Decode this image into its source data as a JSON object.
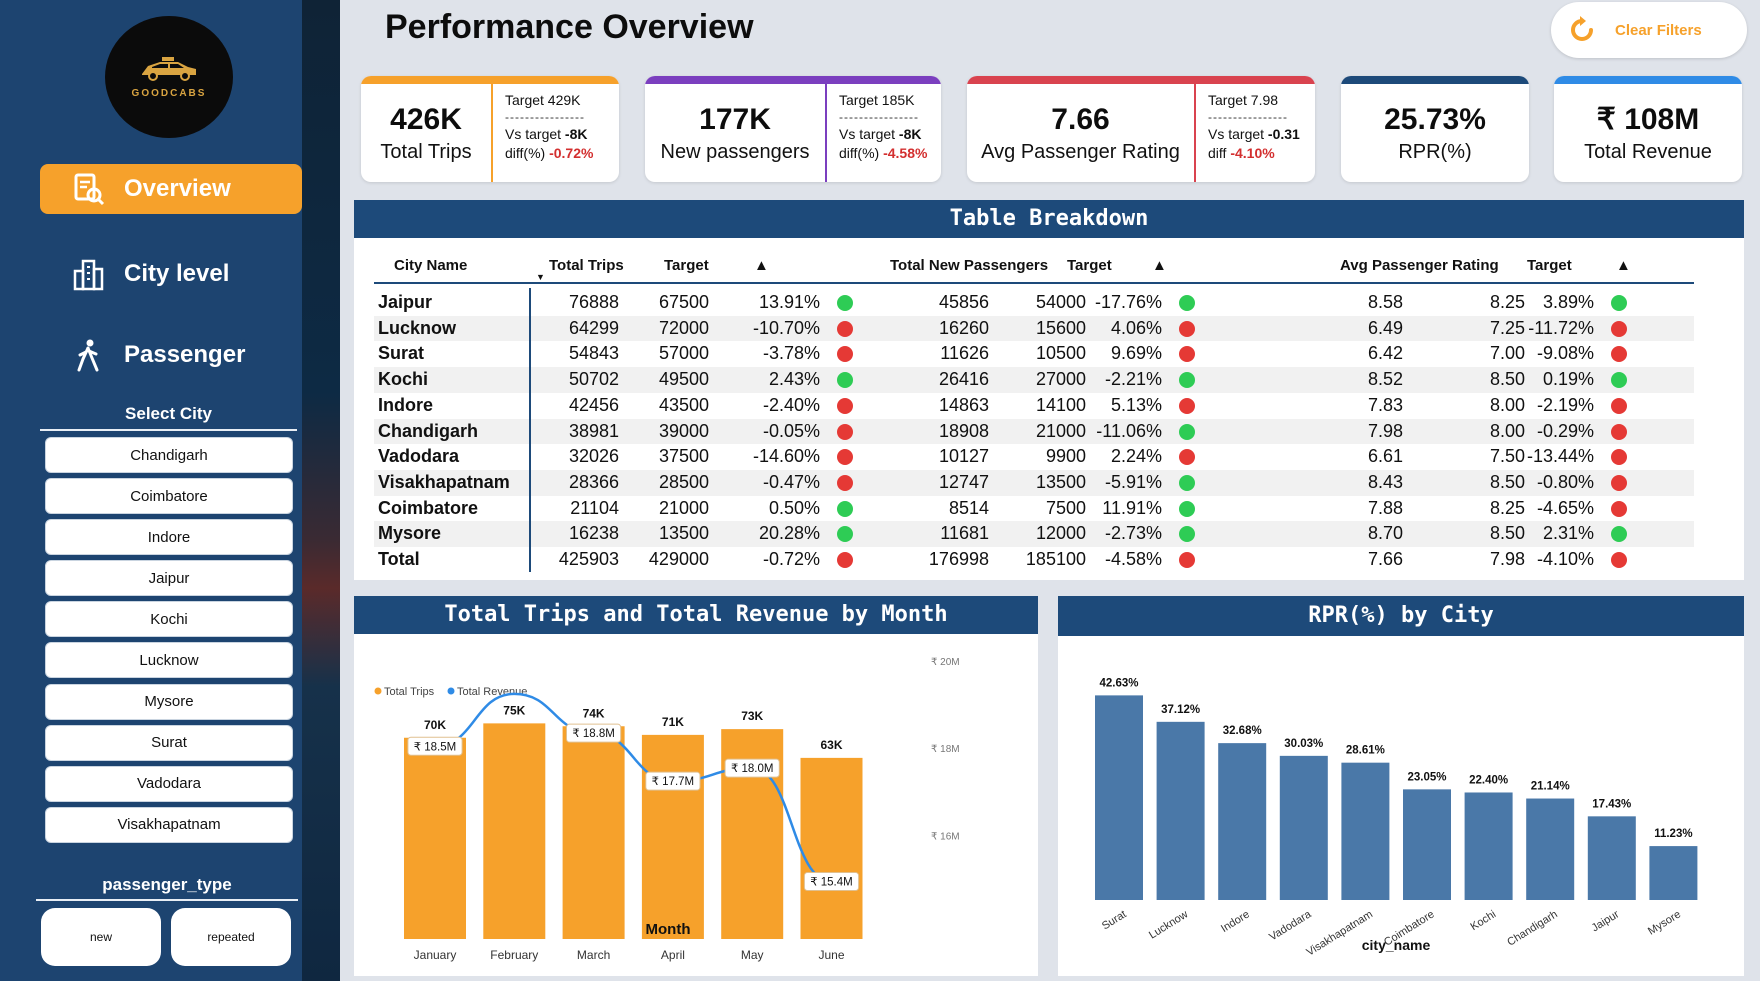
{
  "app": {
    "logo_text": "GOODCABS",
    "page_title": "Performance Overview",
    "clear_filters": "Clear Filters"
  },
  "nav": [
    {
      "label": "Overview",
      "icon": "report-search-icon",
      "active": true
    },
    {
      "label": "City level",
      "icon": "city-buildings-icon",
      "active": false
    },
    {
      "label": "Passenger",
      "icon": "walking-person-icon",
      "active": false
    }
  ],
  "select_city": {
    "title": "Select City",
    "cities": [
      "Chandigarh",
      "Coimbatore",
      "Indore",
      "Jaipur",
      "Kochi",
      "Lucknow",
      "Mysore",
      "Surat",
      "Vadodara",
      "Visakhapatnam"
    ]
  },
  "passenger_type": {
    "title": "passenger_type",
    "options": [
      "new",
      "repeated"
    ]
  },
  "kpis": [
    {
      "value": "426K",
      "label": "Total Trips",
      "target": "Target 429K",
      "dash": "----------------",
      "vs_label": "Vs target",
      "vs": "-8K",
      "diff_label": "diff(%)",
      "diff": "-0.72%",
      "color": "#f6a12b"
    },
    {
      "value": "177K",
      "label": "New passengers",
      "target": "Target 185K",
      "dash": "----------------",
      "vs_label": "Vs target",
      "vs": "-8K",
      "diff_label": "diff(%)",
      "diff": "-4.58%",
      "color": "#7b3fbf"
    },
    {
      "value": "7.66",
      "label": "Avg Passenger Rating",
      "target": "Target 7.98",
      "dash": "----------------",
      "vs_label": "Vs target",
      "vs": "-0.31",
      "diff_label": "diff",
      "diff": "-4.10%",
      "color": "#d9434f"
    },
    {
      "value": "25.73%",
      "label": "RPR(%)",
      "color": "#1d4a7a"
    },
    {
      "value": "₹ 108M",
      "label": "Total Revenue",
      "color": "#2f8be6"
    }
  ],
  "table": {
    "title": "Table Breakdown",
    "headers": [
      "City Name",
      "Total Trips",
      "Target",
      "▲",
      "Total New Passengers",
      "Target",
      "▲",
      "Avg Passenger Rating",
      "Target",
      "▲"
    ],
    "rows": [
      {
        "city": "Jaipur",
        "trips": "76888",
        "trips_target": "67500",
        "trips_diff": "13.91%",
        "trips_status": "green",
        "newp": "45856",
        "newp_target": "54000",
        "newp_diff": "-17.76%",
        "newp_status": "green",
        "rating": "8.58",
        "rating_target": "8.25",
        "rating_diff": "3.89%",
        "rating_status": "green"
      },
      {
        "city": "Lucknow",
        "trips": "64299",
        "trips_target": "72000",
        "trips_diff": "-10.70%",
        "trips_status": "red",
        "newp": "16260",
        "newp_target": "15600",
        "newp_diff": "4.06%",
        "newp_status": "red",
        "rating": "6.49",
        "rating_target": "7.25",
        "rating_diff": "-11.72%",
        "rating_status": "red"
      },
      {
        "city": "Surat",
        "trips": "54843",
        "trips_target": "57000",
        "trips_diff": "-3.78%",
        "trips_status": "red",
        "newp": "11626",
        "newp_target": "10500",
        "newp_diff": "9.69%",
        "newp_status": "red",
        "rating": "6.42",
        "rating_target": "7.00",
        "rating_diff": "-9.08%",
        "rating_status": "red"
      },
      {
        "city": "Kochi",
        "trips": "50702",
        "trips_target": "49500",
        "trips_diff": "2.43%",
        "trips_status": "green",
        "newp": "26416",
        "newp_target": "27000",
        "newp_diff": "-2.21%",
        "newp_status": "green",
        "rating": "8.52",
        "rating_target": "8.50",
        "rating_diff": "0.19%",
        "rating_status": "green"
      },
      {
        "city": "Indore",
        "trips": "42456",
        "trips_target": "43500",
        "trips_diff": "-2.40%",
        "trips_status": "red",
        "newp": "14863",
        "newp_target": "14100",
        "newp_diff": "5.13%",
        "newp_status": "red",
        "rating": "7.83",
        "rating_target": "8.00",
        "rating_diff": "-2.19%",
        "rating_status": "red"
      },
      {
        "city": "Chandigarh",
        "trips": "38981",
        "trips_target": "39000",
        "trips_diff": "-0.05%",
        "trips_status": "red",
        "newp": "18908",
        "newp_target": "21000",
        "newp_diff": "-11.06%",
        "newp_status": "green",
        "rating": "7.98",
        "rating_target": "8.00",
        "rating_diff": "-0.29%",
        "rating_status": "red"
      },
      {
        "city": "Vadodara",
        "trips": "32026",
        "trips_target": "37500",
        "trips_diff": "-14.60%",
        "trips_status": "red",
        "newp": "10127",
        "newp_target": "9900",
        "newp_diff": "2.24%",
        "newp_status": "red",
        "rating": "6.61",
        "rating_target": "7.50",
        "rating_diff": "-13.44%",
        "rating_status": "red"
      },
      {
        "city": "Visakhapatnam",
        "trips": "28366",
        "trips_target": "28500",
        "trips_diff": "-0.47%",
        "trips_status": "red",
        "newp": "12747",
        "newp_target": "13500",
        "newp_diff": "-5.91%",
        "newp_status": "green",
        "rating": "8.43",
        "rating_target": "8.50",
        "rating_diff": "-0.80%",
        "rating_status": "red"
      },
      {
        "city": "Coimbatore",
        "trips": "21104",
        "trips_target": "21000",
        "trips_diff": "0.50%",
        "trips_status": "green",
        "newp": "8514",
        "newp_target": "7500",
        "newp_diff": "11.91%",
        "newp_status": "green",
        "rating": "7.88",
        "rating_target": "8.25",
        "rating_diff": "-4.65%",
        "rating_status": "red"
      },
      {
        "city": "Mysore",
        "trips": "16238",
        "trips_target": "13500",
        "trips_diff": "20.28%",
        "trips_status": "green",
        "newp": "11681",
        "newp_target": "12000",
        "newp_diff": "-2.73%",
        "newp_status": "green",
        "rating": "8.70",
        "rating_target": "8.50",
        "rating_diff": "2.31%",
        "rating_status": "green"
      },
      {
        "city": "Total",
        "trips": "425903",
        "trips_target": "429000",
        "trips_diff": "-0.72%",
        "trips_status": "red",
        "newp": "176998",
        "newp_target": "185100",
        "newp_diff": "-4.58%",
        "newp_status": "red",
        "rating": "7.66",
        "rating_target": "7.98",
        "rating_diff": "-4.10%",
        "rating_status": "red"
      }
    ]
  },
  "colors": {
    "green": "#2ecc55",
    "red": "#e53935",
    "orange": "#f6a12b",
    "navy": "#1d4a7a",
    "steel": "#4a78a8",
    "line": "#2f8be6"
  },
  "chart_data": [
    {
      "type": "bar",
      "title": "Total Trips and Total Revenue by Month",
      "xlabel": "Month",
      "categories": [
        "January",
        "February",
        "March",
        "April",
        "May",
        "June"
      ],
      "series": [
        {
          "name": "Total Trips",
          "type": "bar",
          "values": [
            70000,
            75000,
            74000,
            71000,
            73000,
            63000
          ],
          "labels": [
            "70K",
            "75K",
            "74K",
            "71K",
            "73K",
            "63K"
          ]
        },
        {
          "name": "Total Revenue",
          "type": "line",
          "values": [
            18.5,
            19.7,
            18.8,
            17.7,
            18.0,
            15.4
          ],
          "labels": [
            "₹ 18.5M",
            "",
            "₹ 18.8M",
            "₹ 17.7M",
            "₹ 18.0M",
            "₹ 15.4M"
          ]
        }
      ],
      "y2_ticks": [
        "₹ 20M",
        "₹ 18M",
        "₹ 16M"
      ],
      "y2lim": [
        15,
        20.5
      ],
      "legend": "top-left"
    },
    {
      "type": "bar",
      "title": "RPR(%) by City",
      "xlabel": "city_name",
      "categories": [
        "Surat",
        "Lucknow",
        "Indore",
        "Vadodara",
        "Visakhapatnam",
        "Coimbatore",
        "Kochi",
        "Chandigarh",
        "Jaipur",
        "Mysore"
      ],
      "values": [
        42.63,
        37.12,
        32.68,
        30.03,
        28.61,
        23.05,
        22.4,
        21.14,
        17.43,
        11.23
      ],
      "labels": [
        "42.63%",
        "37.12%",
        "32.68%",
        "30.03%",
        "28.61%",
        "23.05%",
        "22.40%",
        "21.14%",
        "17.43%",
        "11.23%"
      ]
    }
  ]
}
